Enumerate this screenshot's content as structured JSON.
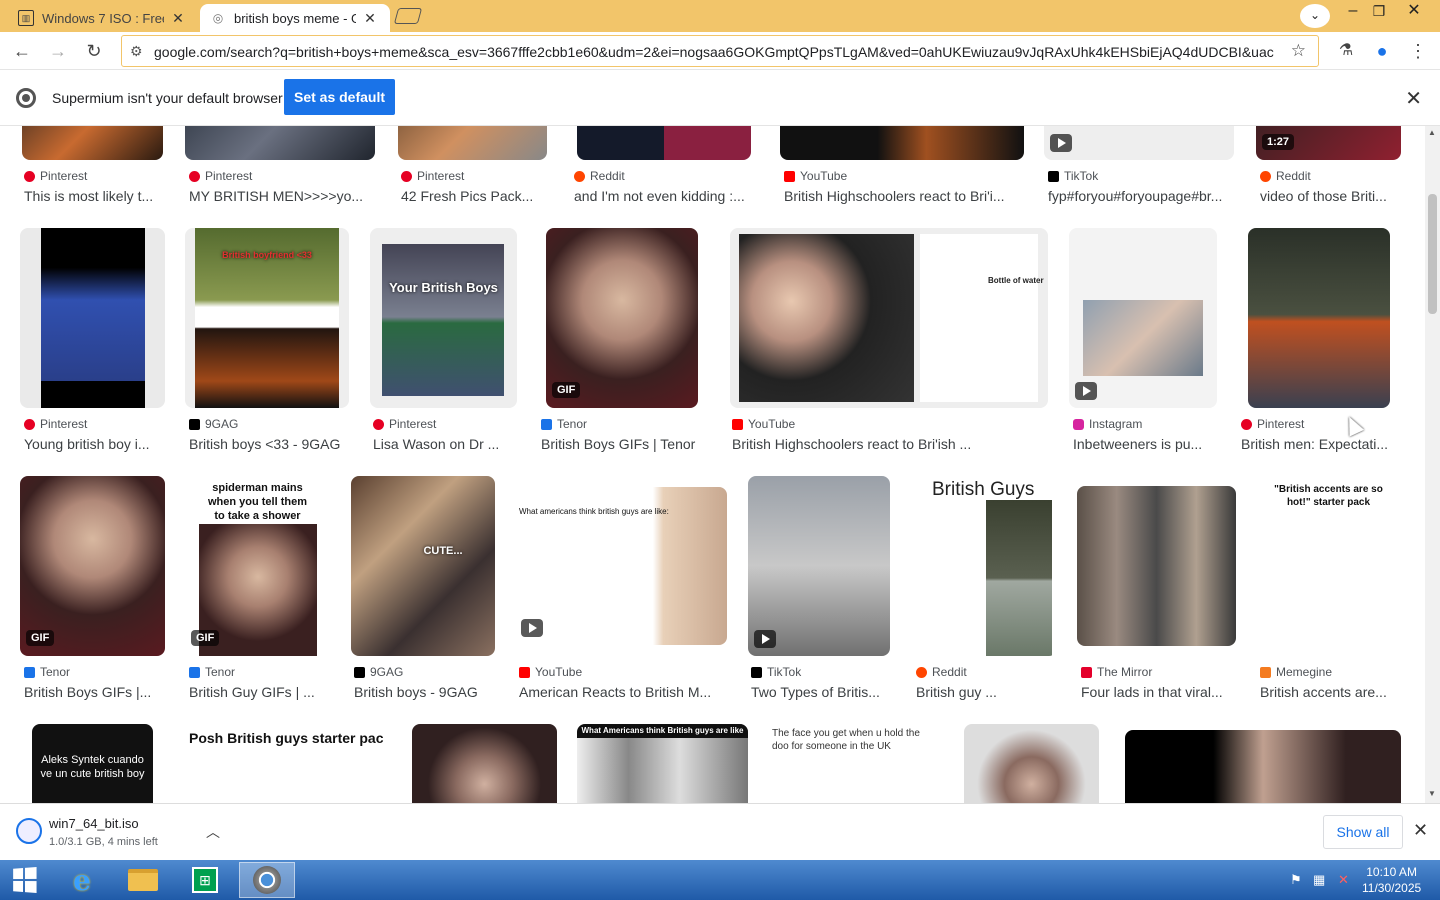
{
  "tabs": [
    {
      "label": "Windows 7 ISO : Free D",
      "active": false
    },
    {
      "label": "british boys meme - Go",
      "active": true
    }
  ],
  "address": {
    "url": "google.com/search?q=british+boys+meme&sca_esv=3667fffe2cbb1e60&udm=2&ei=nogsaa6GOKGmptQPpsTLgAM&ved=0ahUKEwiuzau9vJqRAxUhk4kEHSbiEjAQ4dUDCBI&uact..."
  },
  "infobar": {
    "message": "Supermium isn't your default browser",
    "button": "Set as default"
  },
  "results": [
    {
      "source": "Pinterest",
      "caption": "This is most likely t...",
      "fav": "#e60023"
    },
    {
      "source": "Pinterest",
      "caption": "MY BRITISH MEN>>>>yo...",
      "fav": "#e60023"
    },
    {
      "source": "Pinterest",
      "caption": "42 Fresh Pics Pack...",
      "fav": "#e60023"
    },
    {
      "source": "Reddit",
      "caption": "and I'm not even kidding :...",
      "fav": "#ff4500"
    },
    {
      "source": "YouTube",
      "caption": "British Highschoolers react to Bri'i...",
      "fav": "#ff0000"
    },
    {
      "source": "TikTok",
      "caption": "fyp#foryou#foryoupage#br...",
      "fav": "#000000",
      "badge": ""
    },
    {
      "source": "Reddit",
      "caption": "video of those Briti...",
      "fav": "#ff4500",
      "badge": "1:27"
    },
    {
      "source": "Pinterest",
      "caption": "Young british boy i...",
      "fav": "#e60023"
    },
    {
      "source": "9GAG",
      "caption": "British boys <33 - 9GAG",
      "fav": "#000000",
      "thumb_text": "British boyfriend <33"
    },
    {
      "source": "Pinterest",
      "caption": "Lisa Wason on Dr ...",
      "fav": "#e60023",
      "thumb_text": "Your British Boys"
    },
    {
      "source": "Tenor",
      "caption": "British Boys GIFs | Tenor",
      "fav": "#1a73e8",
      "badge": "GIF"
    },
    {
      "source": "YouTube",
      "caption": "British Highschoolers react to Bri'ish ...",
      "fav": "#ff0000",
      "thumb_text": "Bottle of water"
    },
    {
      "source": "Instagram",
      "caption": "Inbetweeners is pu...",
      "fav": "#d6249f"
    },
    {
      "source": "Pinterest",
      "caption": "British men: Expectati...",
      "fav": "#e60023"
    },
    {
      "source": "Tenor",
      "caption": "British Boys GIFs |...",
      "fav": "#1a73e8",
      "badge": "GIF"
    },
    {
      "source": "Tenor",
      "caption": "British Guy GIFs | ...",
      "fav": "#1a73e8",
      "badge": "GIF",
      "thumb_text": "spiderman mains when you tell them to take a shower"
    },
    {
      "source": "9GAG",
      "caption": "British boys - 9GAG",
      "fav": "#000000",
      "thumb_text": "CUTE..."
    },
    {
      "source": "YouTube",
      "caption": "American Reacts to British M...",
      "fav": "#ff0000",
      "thumb_text": "What americans think british guys are like:"
    },
    {
      "source": "TikTok",
      "caption": "Two Types of Britis...",
      "fav": "#000000"
    },
    {
      "source": "Reddit",
      "caption": "British guy ...",
      "fav": "#ff4500",
      "thumb_text": "British Guys"
    },
    {
      "source": "The Mirror",
      "caption": "Four lads in that viral...",
      "fav": "#e4002b"
    },
    {
      "source": "Memegine",
      "caption": "British accents are...",
      "fav": "#f47b20",
      "thumb_text": "\"British accents are so hot!\" starter pack"
    },
    {
      "source": "",
      "caption": "",
      "fav": "#000000",
      "thumb_text": "Aleks Syntek cuando ve un cute british boy"
    },
    {
      "source": "",
      "caption": "",
      "fav": "#000000",
      "thumb_text": "Posh British guys starter pac"
    },
    {
      "source": "",
      "caption": "",
      "fav": "#000000"
    },
    {
      "source": "",
      "caption": "",
      "fav": "#000000",
      "thumb_text": "What Americans think British guys are like"
    },
    {
      "source": "",
      "caption": "",
      "fav": "#000000",
      "thumb_text": "The face you get when u hold the doo for someone in the UK"
    },
    {
      "source": "",
      "caption": "",
      "fav": "#000000"
    },
    {
      "source": "",
      "caption": "",
      "fav": "#000000"
    }
  ],
  "download": {
    "filename": "win7_64_bit.iso",
    "status": "1.0/3.1 GB, 4 mins left",
    "show_all": "Show all"
  },
  "clock": {
    "time": "10:10 AM",
    "date": "11/30/2025"
  }
}
